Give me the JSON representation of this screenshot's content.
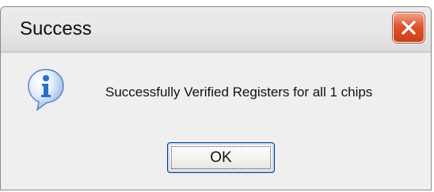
{
  "window": {
    "title": "Success",
    "close_icon": "close-icon"
  },
  "content": {
    "icon": "info-icon",
    "message": "Successfully Verified Registers for all 1 chips"
  },
  "buttons": {
    "ok_label": "OK"
  },
  "colors": {
    "close_button": "#e0542f",
    "info_icon": "#2a6fc9",
    "button_border": "#003c74"
  }
}
